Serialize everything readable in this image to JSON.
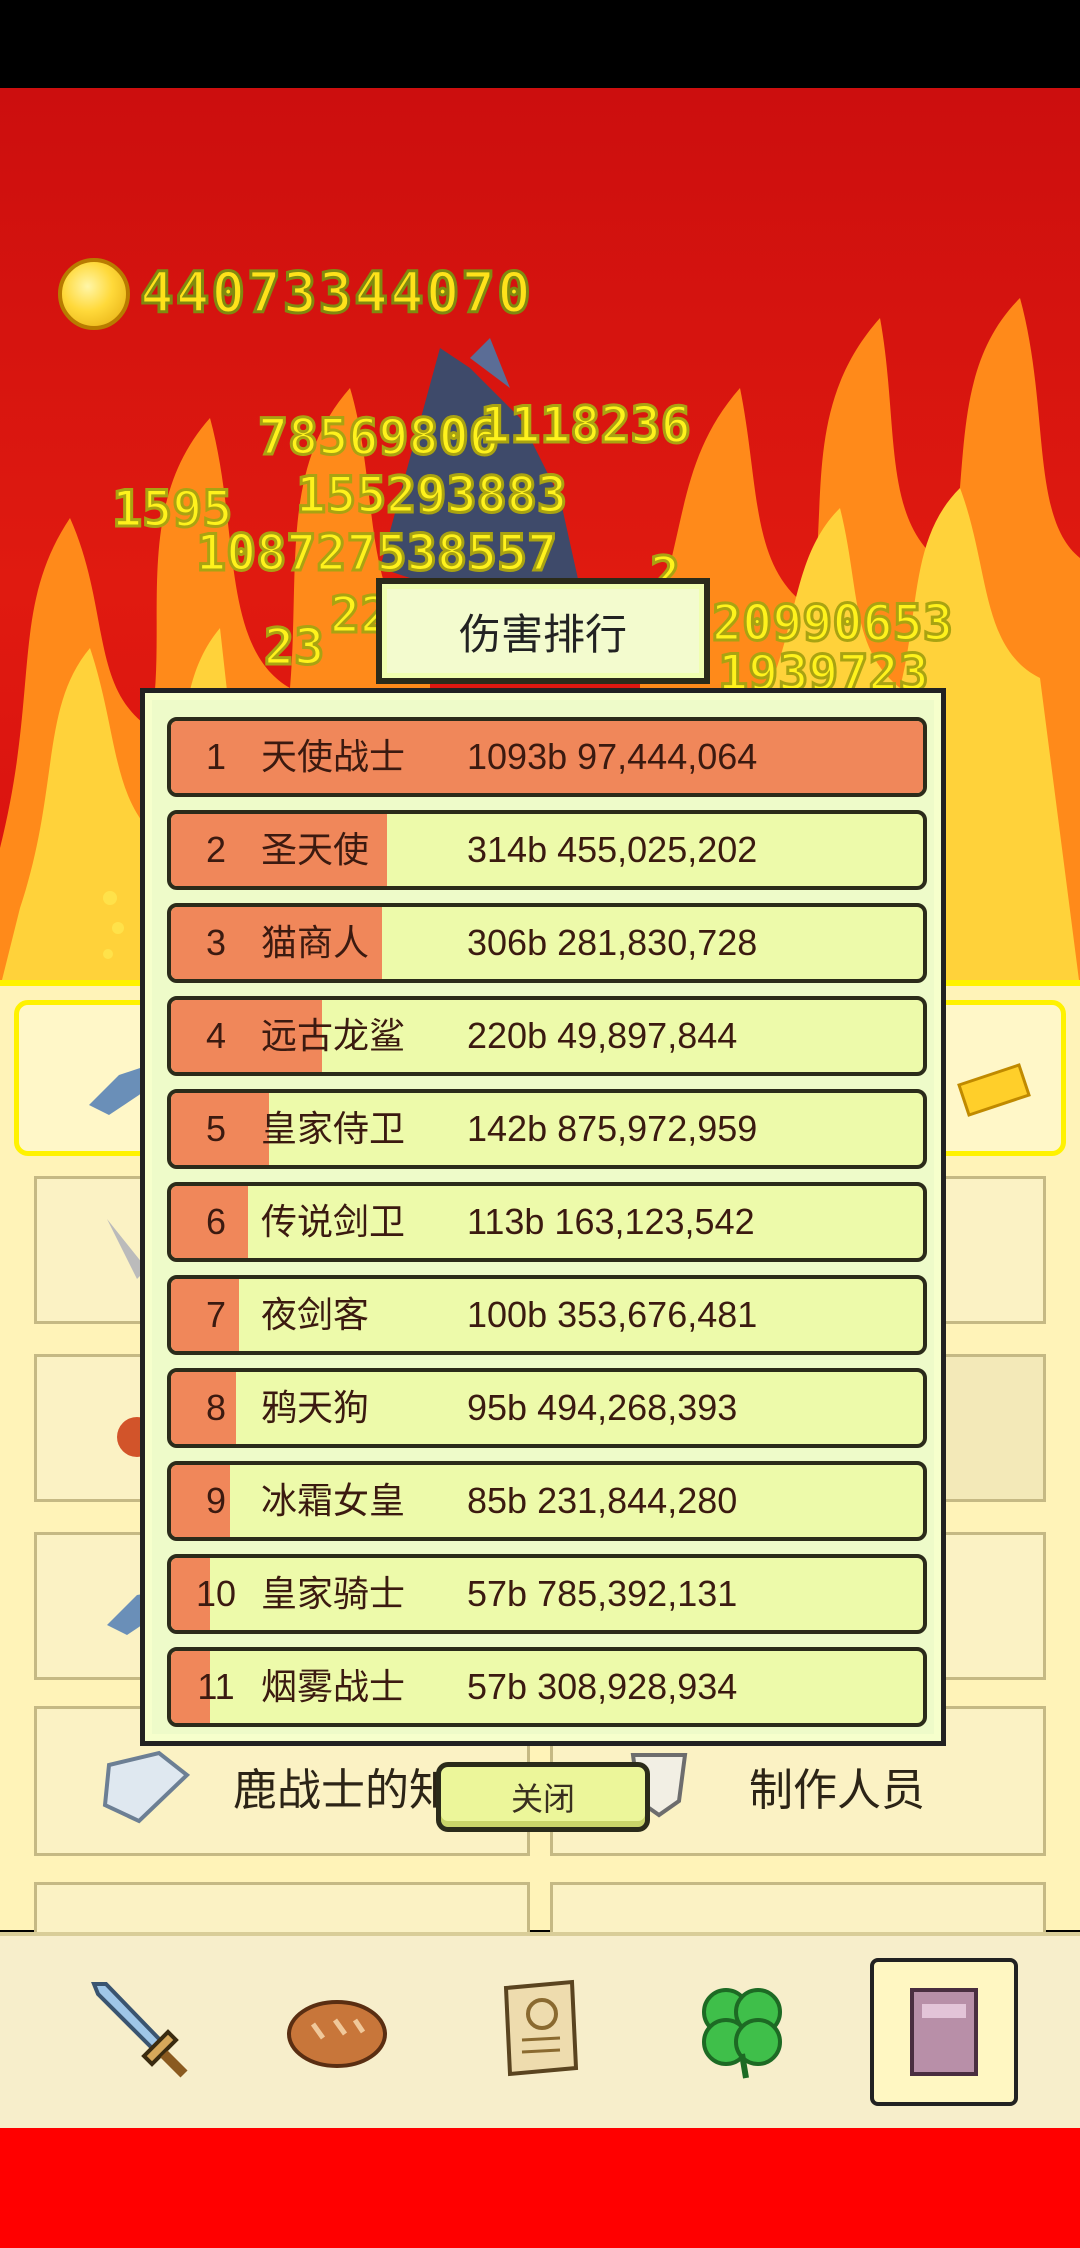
{
  "coins": {
    "amount": "44073344070"
  },
  "damage_popups": [
    "78569806",
    "1118236",
    "1595",
    "155293883",
    "108727538557",
    "20990653",
    "1939723",
    "22",
    "23",
    "2"
  ],
  "background_menu": {
    "cards": [
      "鹿战士的知识",
      "制作人员"
    ]
  },
  "ranking": {
    "title": "伤害排行",
    "close_label": "关闭",
    "rows": [
      {
        "rank": "1",
        "name": "天使战士",
        "value": "1093b 97,444,064",
        "share": 1.0
      },
      {
        "rank": "2",
        "name": "圣天使",
        "value": "314b 455,025,202",
        "share": 0.287
      },
      {
        "rank": "3",
        "name": "猫商人",
        "value": "306b 281,830,728",
        "share": 0.28
      },
      {
        "rank": "4",
        "name": "远古龙鲨",
        "value": "220b 49,897,844",
        "share": 0.201
      },
      {
        "rank": "5",
        "name": "皇家侍卫",
        "value": "142b 875,972,959",
        "share": 0.13
      },
      {
        "rank": "6",
        "name": "传说剑卫",
        "value": "113b 163,123,542",
        "share": 0.103
      },
      {
        "rank": "7",
        "name": "夜剑客",
        "value": "100b 353,676,481",
        "share": 0.091
      },
      {
        "rank": "8",
        "name": "鸦天狗",
        "value": "95b 494,268,393",
        "share": 0.087
      },
      {
        "rank": "9",
        "name": "冰霜女皇",
        "value": "85b 231,844,280",
        "share": 0.078
      },
      {
        "rank": "10",
        "name": "皇家骑士",
        "value": "57b 785,392,131",
        "share": 0.052
      },
      {
        "rank": "11",
        "name": "烟雾战士",
        "value": "57b 308,928,934",
        "share": 0.052
      }
    ]
  },
  "nav": {
    "items": [
      "sword-icon",
      "bread-icon",
      "scroll-icon",
      "clover-icon",
      "book-icon"
    ],
    "selected": 4
  },
  "colors": {
    "accent": "#f0875a",
    "fire": "#e01a10",
    "panel": "#fff3b8"
  }
}
